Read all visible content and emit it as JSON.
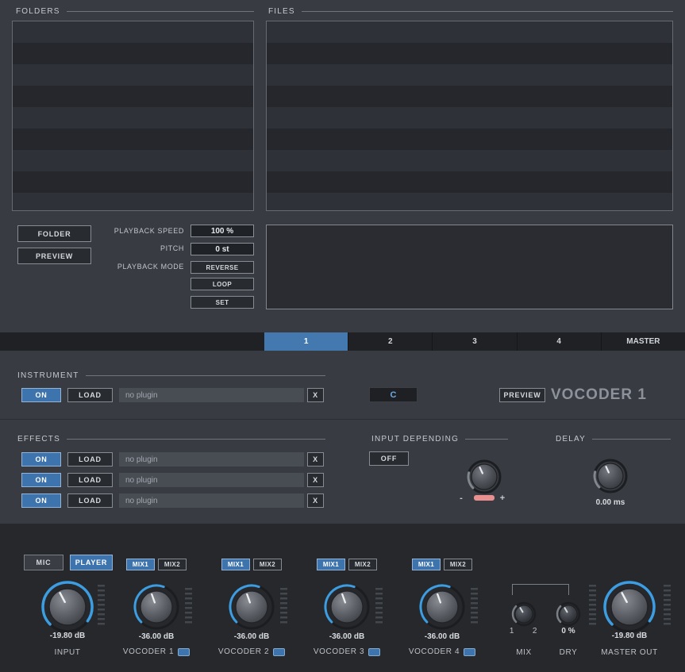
{
  "browser": {
    "folders_label": "FOLDERS",
    "files_label": "FILES"
  },
  "playback": {
    "folder_button": "FOLDER",
    "preview_button": "PREVIEW",
    "speed_label": "PLAYBACK SPEED",
    "speed_value": "100 %",
    "pitch_label": "PITCH",
    "pitch_value": "0 st",
    "mode_label": "PLAYBACK  MODE",
    "reverse_button": "REVERSE",
    "loop_button": "LOOP",
    "set_button": "SET"
  },
  "tabs": {
    "tab1": "1",
    "tab2": "2",
    "tab3": "3",
    "tab4": "4",
    "master": "MASTER"
  },
  "instrument": {
    "section_label": "INSTRUMENT",
    "on_button": "ON",
    "load_button": "LOAD",
    "plugin_name": "no plugin",
    "clear_button": "X",
    "key_display": "C",
    "preview_button": "PREVIEW",
    "title": "VOCODER 1"
  },
  "effects": {
    "section_label": "EFFECTS",
    "on_button": "ON",
    "load_button": "LOAD",
    "clear_button": "X",
    "slots": [
      "no plugin",
      "no plugin",
      "no plugin"
    ],
    "input_depending_label": "INPUT DEPENDING",
    "off_button": "OFF",
    "minus_label": "-",
    "plus_label": "+",
    "delay_label": "DELAY",
    "delay_value": "0.00 ms"
  },
  "mixer": {
    "mic_button": "MIC",
    "player_button": "PLAYER",
    "mix1_button": "MIX1",
    "mix2_button": "MIX2",
    "input": {
      "value": "-19.80 dB",
      "label": "INPUT"
    },
    "vocoder1": {
      "value": "-36.00 dB",
      "label": "VOCODER 1"
    },
    "vocoder2": {
      "value": "-36.00 dB",
      "label": "VOCODER 2"
    },
    "vocoder3": {
      "value": "-36.00 dB",
      "label": "VOCODER 3"
    },
    "vocoder4": {
      "value": "-36.00 dB",
      "label": "VOCODER 4"
    },
    "mix": {
      "label": "MIX",
      "in1": "1",
      "in2": "2"
    },
    "dry": {
      "label": "DRY",
      "value": "0 %"
    },
    "master": {
      "value": "-19.80 dB",
      "label": "MASTER OUT"
    }
  },
  "colors": {
    "accent_blue": "#3e74ae",
    "knob_arc_blue": "#3d9de0",
    "indicator_red": "#e89090"
  }
}
